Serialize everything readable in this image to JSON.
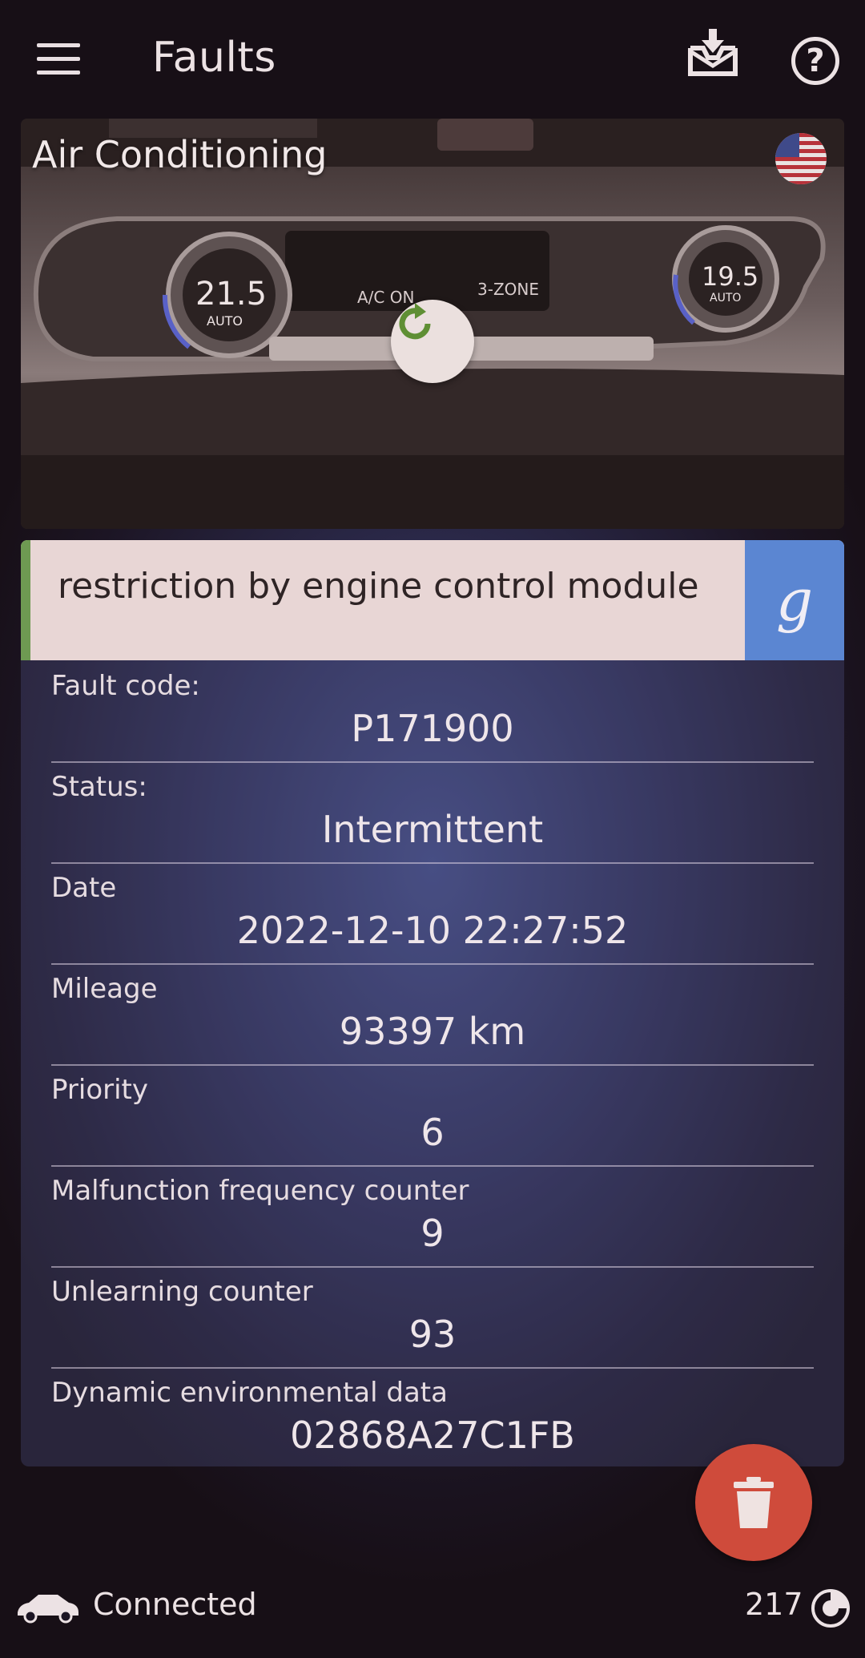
{
  "header": {
    "title": "Faults",
    "menu_icon": "hamburger-menu-icon",
    "download_icon": "inbox-download-icon",
    "help_icon": "help-circle-icon",
    "help_glyph": "?"
  },
  "module": {
    "title": "Air Conditioning",
    "flag_icon": "us-flag-icon",
    "refresh_icon": "refresh-icon"
  },
  "fault": {
    "description": "restriction by engine control module",
    "search_button_label": "g",
    "accent_color": "#6e9a52",
    "search_button_color": "#5b86d2",
    "fields": [
      {
        "label": "Fault code:",
        "value": "P171900"
      },
      {
        "label": "Status:",
        "value": "Intermittent"
      },
      {
        "label": "Date",
        "value": "2022-12-10 22:27:52"
      },
      {
        "label": "Mileage",
        "value": "93397 km"
      },
      {
        "label": "Priority",
        "value": "6"
      },
      {
        "label": "Malfunction frequency counter",
        "value": "9"
      },
      {
        "label": "Unlearning counter",
        "value": "93"
      },
      {
        "label": "Dynamic environmental data",
        "value": "02868A27C1FB"
      }
    ]
  },
  "actions": {
    "delete_icon": "trash-icon",
    "delete_color": "#cf4b3b"
  },
  "status_bar": {
    "connection": "Connected",
    "connection_icon": "car-icon",
    "counter": "217",
    "counter_icon": "circular-gauge-icon"
  }
}
